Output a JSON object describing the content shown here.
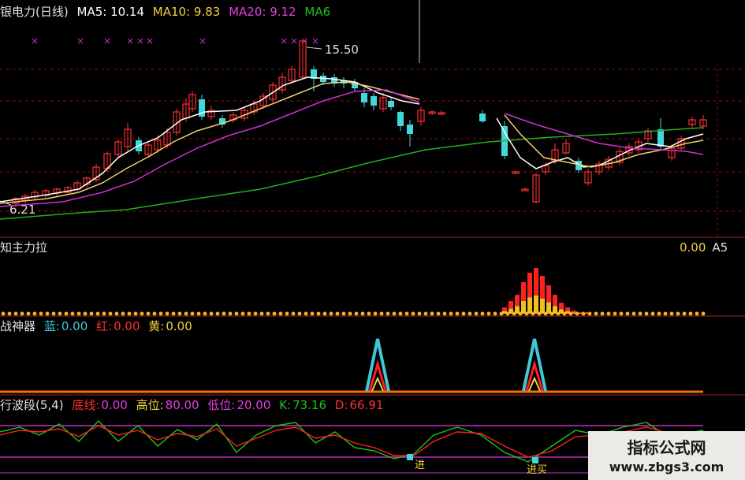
{
  "panel1": {
    "title": "银电力(日线)",
    "ma5": "MA5: 10.14",
    "ma10": "MA10: 9.83",
    "ma20": "MA20: 9.12",
    "ma60": "MA6",
    "high_label": "15.50",
    "low_label": "6.21",
    "colors": {
      "ma5": "#ffffff",
      "ma10": "#f0d070",
      "ma20": "#d030d0",
      "ma60": "#20b020",
      "up": "#ff3030",
      "down": "#40d8d8"
    }
  },
  "panel2": {
    "title": "知主力拉",
    "right_value": "0.00",
    "right_tag": "A5"
  },
  "panel3": {
    "title": "战神器",
    "blue_label": "蓝:",
    "blue_value": "0.00",
    "red_label": "红:",
    "red_value": "0.00",
    "yellow_label": "黄:",
    "yellow_value": "0.00"
  },
  "panel4": {
    "title": "行波段(5,4)",
    "base_label": "底线:",
    "base_value": "0.00",
    "high_label": "高位:",
    "high_value": "80.00",
    "low_label": "低位:",
    "low_value": "20.00",
    "k_label": "K:",
    "k_value": "73.16",
    "d_label": "D:",
    "d_value": "66.91",
    "marker1": "进",
    "marker2": "进买"
  },
  "watermark": {
    "line1": "指标公式网",
    "line2": "www.zbgs3.com"
  }
}
